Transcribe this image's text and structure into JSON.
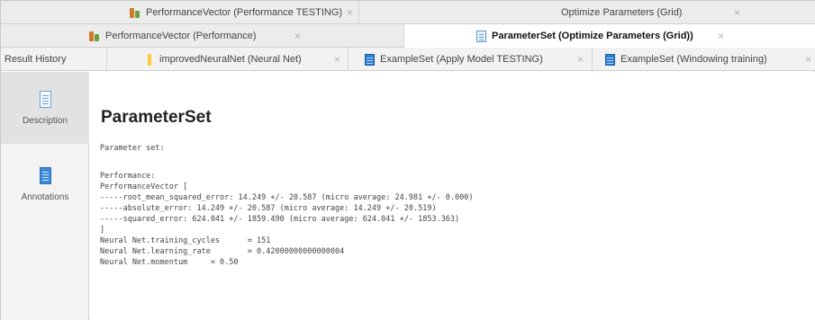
{
  "tabs_row1": [
    {
      "label": "PerformanceVector (Performance TESTING)",
      "icon": "performance-icon"
    },
    {
      "label": "Optimize Parameters (Grid)"
    }
  ],
  "tabs_row2": [
    {
      "label": "PerformanceVector (Performance)",
      "icon": "performance-icon"
    },
    {
      "label": "ParameterSet (Optimize Parameters (Grid))",
      "icon": "document-icon",
      "active": true
    }
  ],
  "tabs_row3": [
    {
      "label": "Result History"
    },
    {
      "label": "improvedNeuralNet (Neural Net)",
      "icon": "model-icon"
    },
    {
      "label": "ExampleSet (Apply Model TESTING)",
      "icon": "table-icon"
    },
    {
      "label": "ExampleSet (Windowing training)",
      "icon": "table-icon"
    }
  ],
  "close_glyph": "×",
  "sidebar": {
    "items": [
      {
        "label": "Description",
        "icon": "description-icon",
        "active": true
      },
      {
        "label": "Annotations",
        "icon": "annotations-icon"
      }
    ]
  },
  "content": {
    "title": "ParameterSet",
    "header_line": "Parameter set:",
    "lines": [
      "Performance:",
      "PerformanceVector [",
      "-----root_mean_squared_error: 14.249 +/- 20.587 (micro average: 24.981 +/- 0.000)",
      "-----absolute_error: 14.249 +/- 20.587 (micro average: 14.249 +/- 20.519)",
      "-----squared_error: 624.041 +/- 1859.490 (micro average: 624.041 +/- 1853.363)",
      "]",
      "Neural Net.training_cycles      = 151",
      "Neural Net.learning_rate        = 0.42000000000000004",
      "Neural Net.momentum     = 0.50"
    ]
  }
}
